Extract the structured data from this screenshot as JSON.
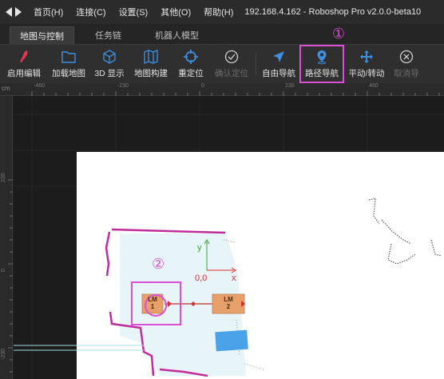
{
  "menubar": {
    "items": [
      "首页(H)",
      "连接(C)",
      "设置(S)",
      "其他(O)",
      "帮助(H)"
    ],
    "title": "192.168.4.162 - Roboshop Pro v2.0.0-beta10"
  },
  "tabs": [
    {
      "label": "地图与控制",
      "active": true
    },
    {
      "label": "任务链",
      "active": false
    },
    {
      "label": "机器人模型",
      "active": false
    }
  ],
  "toolbar": {
    "items": [
      {
        "label": "启用编辑",
        "icon": "pen-icon"
      },
      {
        "label": "加载地图",
        "icon": "folder-icon"
      },
      {
        "label": "3D 显示",
        "icon": "cube-icon"
      },
      {
        "label": "地图构建",
        "icon": "map-icon"
      },
      {
        "label": "重定位",
        "icon": "crosshair-icon"
      },
      {
        "label": "确认定位",
        "icon": "check-circle-icon",
        "disabled": true
      },
      {
        "label": "自由导航",
        "icon": "navigate-arrow-icon"
      },
      {
        "label": "路径导航",
        "icon": "map-pin-icon",
        "highlighted": true
      },
      {
        "label": "平动/转动",
        "icon": "move-icon"
      },
      {
        "label": "取消导",
        "icon": "close-circle-icon",
        "disabled": true
      }
    ]
  },
  "ruler": {
    "unit": "cm",
    "top_labels": [
      "-460",
      "-230",
      "0",
      "230",
      "460"
    ],
    "left_labels": [
      "230",
      "0",
      "-230"
    ]
  },
  "annotations": {
    "marker_1": "①",
    "marker_2": "②"
  },
  "map": {
    "axis_y": "y",
    "axis_x": "x",
    "origin": "0,0",
    "landmarks": [
      {
        "label_top": "LM",
        "label_bottom": "1"
      },
      {
        "label_top": "LM",
        "label_bottom": "2"
      }
    ]
  },
  "colors": {
    "accent_blue": "#3d8fe0",
    "highlight_magenta": "#d94fd8",
    "wall_magenta": "#c02c9c",
    "landmark_orange": "#e8a06a",
    "origin_red": "#e02a2a"
  }
}
